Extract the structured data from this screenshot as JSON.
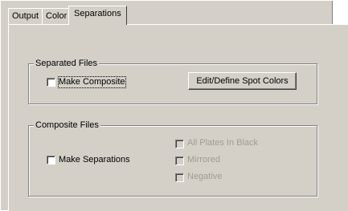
{
  "tabs": [
    {
      "label": "Output",
      "active": false
    },
    {
      "label": "Color",
      "active": false
    },
    {
      "label": "Separations",
      "active": true
    }
  ],
  "separated_files": {
    "legend": "Separated Files",
    "make_composite": {
      "label": "Make Composite",
      "checked": false
    },
    "edit_spot_colors_label": "Edit/Define Spot Colors"
  },
  "composite_files": {
    "legend": "Composite Files",
    "make_separations": {
      "label": "Make Separations",
      "checked": false
    },
    "all_plates_in_black": {
      "label": "All Plates In Black",
      "checked": false,
      "enabled": false
    },
    "mirrored": {
      "label": "Mirrored",
      "checked": false,
      "enabled": false
    },
    "negative": {
      "label": "Negative",
      "checked": false,
      "enabled": false
    }
  }
}
